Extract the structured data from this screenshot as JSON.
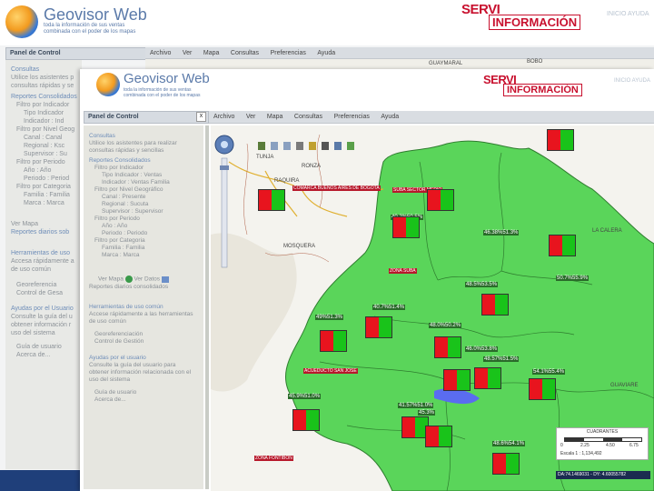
{
  "back_window": {
    "logo_title": "Geovisor Web",
    "logo_sub1": "toda la información de sus ventas",
    "logo_sub2": "combinada con el poder de los mapas",
    "brand_servi": "SERVI",
    "brand_info": "INFORMACIÓN",
    "top_links": "INICIO  AYUDA",
    "panel_title": "Panel de Control",
    "menu": [
      "Archivo",
      "Ver",
      "Mapa",
      "Consultas",
      "Preferencias",
      "Ayuda"
    ],
    "side": [
      "Consultas",
      "Utilice los asistentes p",
      "consultas rápidas y se",
      "Reportes Consolidados",
      "Filtro por Indicador",
      "Tipo Indicador",
      "Indicador : Ind",
      "Filtro por Nivel Geog",
      "Canal : Canal",
      "Regional : Ksc",
      "Supervisor : Su",
      "Filtro por Periodo",
      "Año : Año",
      "Periodo : Period",
      "Filtro por Categoria",
      "Familia : Familia",
      "Marca : Marca",
      "Ver Mapa",
      "Reportes diarios sob",
      "Herramientas de uso",
      "Accesa rápidamente a",
      "de uso común",
      "Georeferencia",
      "Control de Gesa",
      "Ayudas por el Usuario",
      "Consulte la guía del u",
      "obtener información r",
      "uso del sistema",
      "Guía de usuario",
      "Acerca de..."
    ],
    "map_labels": [
      "GUAYMARAL",
      "BOBO"
    ]
  },
  "front_window": {
    "logo_title": "Geovisor Web",
    "logo_sub1": "toda la información de sus ventas",
    "logo_sub2": "combinada con el poder de los mapas",
    "brand_servi": "SERVI",
    "brand_info": "INFORMACIÓN",
    "top_links": "INICIO  AYUDA",
    "panel_title": "Panel de Control",
    "close_btn": "x",
    "menu": [
      "Archivo",
      "Ver",
      "Mapa",
      "Consultas",
      "Preferencias",
      "Ayuda"
    ],
    "side": {
      "consultas_title": "Consultas",
      "consultas_text1": "Utilice los asistentes para realizar",
      "consultas_text2": "consultas rápidas y sencillas",
      "reportes_title": "Reportes Consolidados",
      "items": [
        {
          "text": "Filtro por Indicador",
          "level": 1
        },
        {
          "text": "Tipo Indicador : Ventas",
          "level": 2
        },
        {
          "text": "Indicador : Ventas Familia",
          "level": 2
        },
        {
          "text": "Filtro por Nivel Geográfico",
          "level": 1
        },
        {
          "text": "Canal : Presente",
          "level": 2
        },
        {
          "text": "Regional : Sucuta",
          "level": 2
        },
        {
          "text": "Supervisor : Supervisor",
          "level": 2
        },
        {
          "text": "Filtro por Periodo",
          "level": 1
        },
        {
          "text": "Año : Año",
          "level": 2
        },
        {
          "text": "Periodo : Periodo",
          "level": 2
        },
        {
          "text": "Filtro por Categoria",
          "level": 1
        },
        {
          "text": "Familia : Familia",
          "level": 2
        },
        {
          "text": "Marca : Marca",
          "level": 2
        }
      ],
      "ver_mapa": "Ver Mapa",
      "ver_datos": "Ver Datos",
      "reportes_diarios": "Reportes diarios consolidados",
      "herramientas_title": "Herramientas de uso común",
      "herramientas_text1": "Accese rápidamente a las herramientas",
      "herramientas_text2": "de uso común",
      "georef": "Georeferenciación",
      "control": "Control de Gestión",
      "ayudas_title": "Ayudas por el usuario",
      "ayudas_text1": "Consulte la guía del usuario para",
      "ayudas_text2": "obtener información relacionada con el",
      "ayudas_text3": "uso del sistema",
      "guia": "Guía de usuario",
      "acerca": "Acerca de..."
    },
    "map": {
      "place_labels": [
        "TUNJA",
        "RONZA",
        "RAQUIRA",
        "MOSQUERA",
        "LA CALERA",
        "GUAVIARE"
      ],
      "pct_labels": [
        "40.2%50.5%",
        "46.38%51.3%",
        "50.7%55.9%",
        "48.5%53.5%",
        "49%51.3%",
        "40.7%51.4%",
        "48.0%50.2%",
        "48.57%51.5%",
        "54.1%55.4%",
        "45.9%51.0%",
        "45.3%",
        "41.57%51.0%",
        "46.0%53.8%",
        "48.6%54.1%"
      ],
      "name_labels": [
        "COMARCA BUENOS AIRES DE BOGOTA",
        "SUBA SECTOR MEDIO",
        "ZONA SUBA",
        "ACUEDUCTO SAN JOSE",
        "ZONA FONTIBON"
      ],
      "scale_title": "CUADRANTES",
      "scale_ticks": [
        "0",
        "2.25",
        "4.50",
        "6.75"
      ],
      "scale_text": "Escala 1 : 1,134,492",
      "coord_text": "DA:74.1469031 - DY: 4.60055782"
    }
  }
}
